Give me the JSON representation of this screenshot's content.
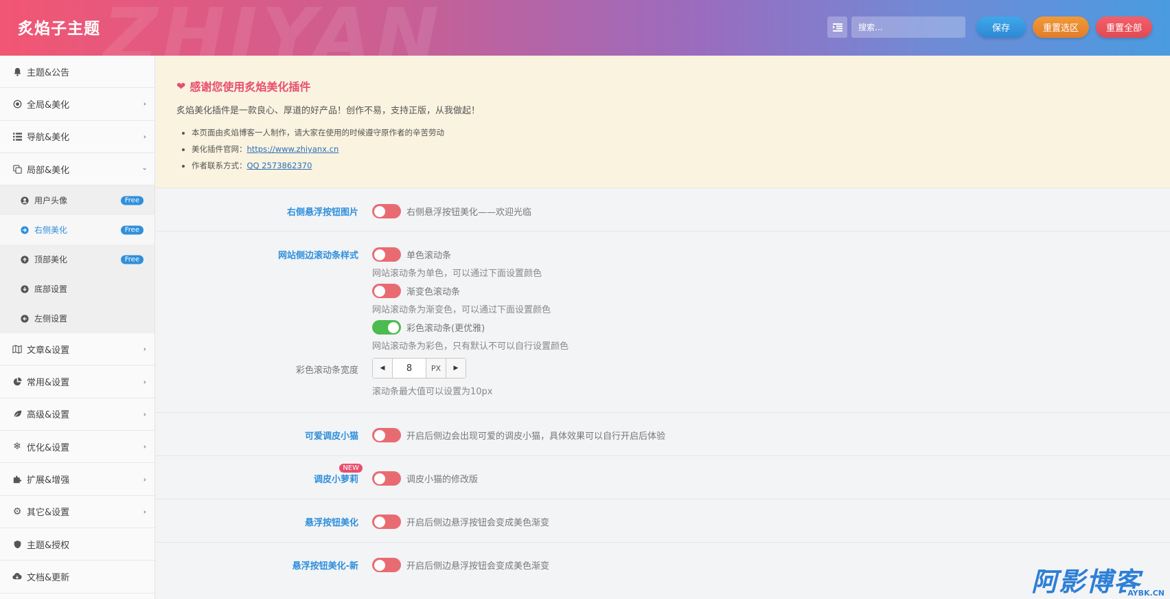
{
  "header": {
    "brand": "炙焰子主题",
    "watermark": "ZHIYAN",
    "search_placeholder": "搜索...",
    "save": "保存",
    "reset_section": "重置选区",
    "reset_all": "重置全部"
  },
  "sidebar": {
    "items": [
      {
        "label": "主题&公告",
        "icon": "bell-icon",
        "chevron": false
      },
      {
        "label": "全局&美化",
        "icon": "radio-icon",
        "chevron": true
      },
      {
        "label": "导航&美化",
        "icon": "list-icon",
        "chevron": true
      },
      {
        "label": "局部&美化",
        "icon": "copy-icon",
        "chevron": true,
        "expanded": true
      }
    ],
    "sub_items": [
      {
        "label": "用户头像",
        "icon": "user-circle-icon",
        "badge": "Free"
      },
      {
        "label": "右侧美化",
        "icon": "arrow-right-circle-icon",
        "badge": "Free",
        "active": true
      },
      {
        "label": "顶部美化",
        "icon": "arrow-up-circle-icon",
        "badge": "Free"
      },
      {
        "label": "底部设置",
        "icon": "arrow-down-circle-icon"
      },
      {
        "label": "左侧设置",
        "icon": "arrow-left-circle-icon"
      }
    ],
    "items_after": [
      {
        "label": "文章&设置",
        "icon": "map-icon",
        "chevron": true
      },
      {
        "label": "常用&设置",
        "icon": "pie-chart-icon",
        "chevron": true
      },
      {
        "label": "高级&设置",
        "icon": "leaf-icon",
        "chevron": true
      },
      {
        "label": "优化&设置",
        "icon": "snowflake-icon",
        "chevron": true
      },
      {
        "label": "扩展&增强",
        "icon": "puzzle-icon",
        "chevron": true
      },
      {
        "label": "其它&设置",
        "icon": "gear-icon",
        "chevron": true
      },
      {
        "label": "主题&授权",
        "icon": "shield-icon",
        "chevron": false
      },
      {
        "label": "文档&更新",
        "icon": "cloud-download-icon",
        "chevron": false
      }
    ]
  },
  "notice": {
    "title": "感谢您使用炙焰美化插件",
    "lead": "炙焰美化插件是一款良心、厚道的好产品！创作不易，支持正版，从我做起！",
    "bullet1": "本页面由炙焰博客一人制作，请大家在使用的时候遵守原作者的辛苦劳动",
    "bullet2_prefix": "美化插件官网：",
    "bullet2_link": "https://www.zhiyanx.cn",
    "bullet3_prefix": "作者联系方式：",
    "bullet3_link": "QQ 2573862370"
  },
  "settings": {
    "float_btn_image": {
      "label": "右侧悬浮按钮图片",
      "text": "右侧悬浮按钮美化——欢迎光临",
      "on": false
    },
    "scrollbar": {
      "label": "网站侧边滚动条样式",
      "opt1": "单色滚动条",
      "opt1_help": "网站滚动条为单色，可以通过下面设置颜色",
      "opt2": "渐变色滚动条",
      "opt2_help": "网站滚动条为渐变色，可以通过下面设置颜色",
      "opt3": "彩色滚动条(更优雅)",
      "opt3_help": "网站滚动条为彩色，只有默认不可以自行设置颜色",
      "width_label": "彩色滚动条宽度",
      "width_value": "8",
      "width_unit": "PX",
      "width_help": "滚动条最大值可以设置为10px"
    },
    "cat": {
      "label": "可爱调皮小猫",
      "text": "开启后侧边会出现可爱的调皮小猫，具体效果可以自行开启后体验"
    },
    "loli": {
      "label": "调皮小萝莉",
      "badge": "NEW",
      "text": "调皮小猫的修改版"
    },
    "float_beauty": {
      "label": "悬浮按钮美化",
      "text": "开启后侧边悬浮按钮会变成美色渐变"
    },
    "float_beauty_new": {
      "label": "悬浮按钮美化-新",
      "text": "开启后侧边悬浮按钮会变成美色渐变"
    }
  },
  "watermark_logo": {
    "text": "阿影博客",
    "sub": "AYBK.CN"
  },
  "colors": {
    "accent": "#2f8fdc",
    "toggle_off": "#e96b72",
    "toggle_on": "#4cbb50",
    "notice_title": "#e74f6e"
  }
}
